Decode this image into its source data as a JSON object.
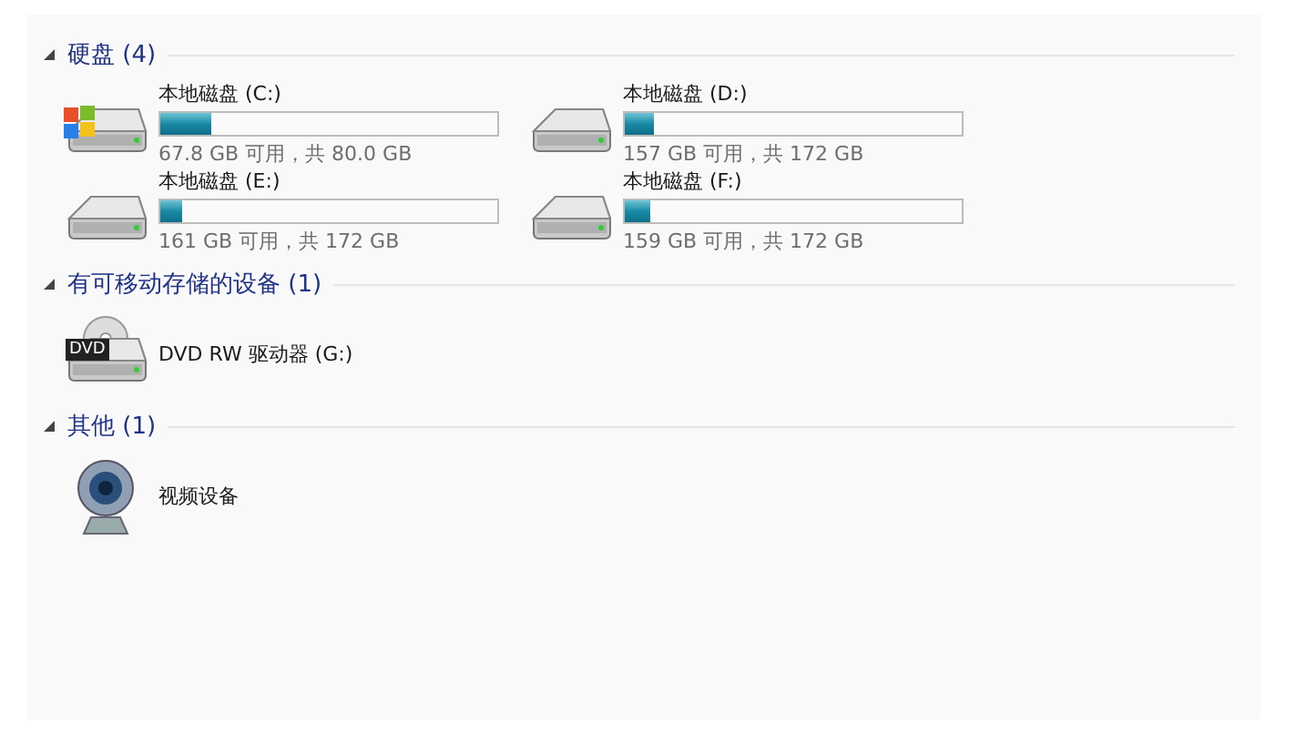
{
  "groups": [
    {
      "title": "硬盘 (4)",
      "expanded": true,
      "items": [
        {
          "kind": "drive",
          "system": true,
          "name": "本地磁盘 (C:)",
          "level": 0.15,
          "space": "67.8 GB 可用，共 80.0 GB"
        },
        {
          "kind": "drive",
          "system": false,
          "name": "本地磁盘 (D:)",
          "level": 0.087,
          "space": "157 GB 可用，共 172 GB"
        },
        {
          "kind": "drive",
          "system": false,
          "name": "本地磁盘 (E:)",
          "level": 0.064,
          "space": "161 GB 可用，共 172 GB"
        },
        {
          "kind": "drive",
          "system": false,
          "name": "本地磁盘 (F:)",
          "level": 0.076,
          "space": "159 GB 可用，共 172 GB"
        }
      ]
    },
    {
      "title": "有可移动存储的设备 (1)",
      "expanded": true,
      "items": [
        {
          "kind": "optical",
          "badge": "DVD",
          "name": "DVD RW 驱动器 (G:)"
        }
      ]
    },
    {
      "title": "其他 (1)",
      "expanded": true,
      "items": [
        {
          "kind": "camera",
          "name": "视频设备"
        }
      ]
    }
  ]
}
